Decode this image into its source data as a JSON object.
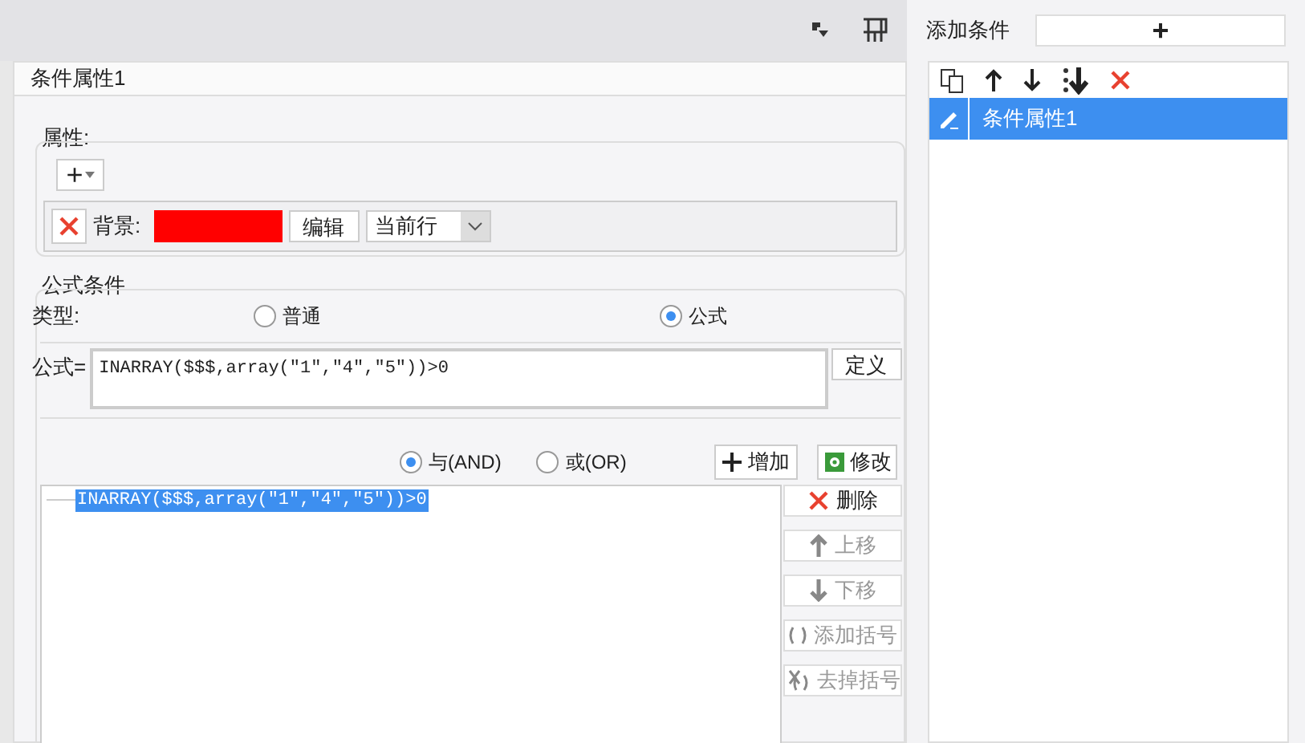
{
  "right_panel": {
    "title": "添加条件",
    "add_button": "+",
    "list_toolbar": [
      {
        "kind": "copy"
      },
      {
        "kind": "up"
      },
      {
        "kind": "down"
      },
      {
        "kind": "bottom"
      },
      {
        "kind": "delete"
      }
    ],
    "conditions": [
      {
        "label": "条件属性1",
        "selected": true
      }
    ]
  },
  "dialog": {
    "title": "条件属性1",
    "attributes": {
      "label": "属性:",
      "add_button": "+",
      "rows": [
        {
          "label": "背景:",
          "color": "#ff0000",
          "edit_button": "编辑",
          "scope": "当前行"
        }
      ]
    },
    "formula": {
      "label": "公式条件",
      "type_label": "类型:",
      "types": [
        {
          "label": "普通",
          "selected": false
        },
        {
          "label": "公式",
          "selected": true
        }
      ],
      "formula_label": "公式=",
      "formula_value": "INARRAY($$$,array(\"1\",\"4\",\"5\"))>0",
      "define_button": "定义",
      "logic": [
        {
          "label": "与(AND)",
          "selected": true
        },
        {
          "label": "或(OR)",
          "selected": false
        }
      ],
      "add_button": "增加",
      "modify_button": "修改",
      "conditions": [
        {
          "text": "INARRAY($$$,array(\"1\",\"4\",\"5\"))>0",
          "selected": true
        }
      ],
      "side_buttons": [
        {
          "kind": "delete",
          "label": "删除",
          "disabled": false
        },
        {
          "kind": "up",
          "label": "上移",
          "disabled": true
        },
        {
          "kind": "down",
          "label": "下移",
          "disabled": true
        },
        {
          "kind": "add_paren",
          "label": "添加括号",
          "disabled": true
        },
        {
          "kind": "remove_paren",
          "label": "去掉括号",
          "disabled": true
        }
      ]
    }
  }
}
